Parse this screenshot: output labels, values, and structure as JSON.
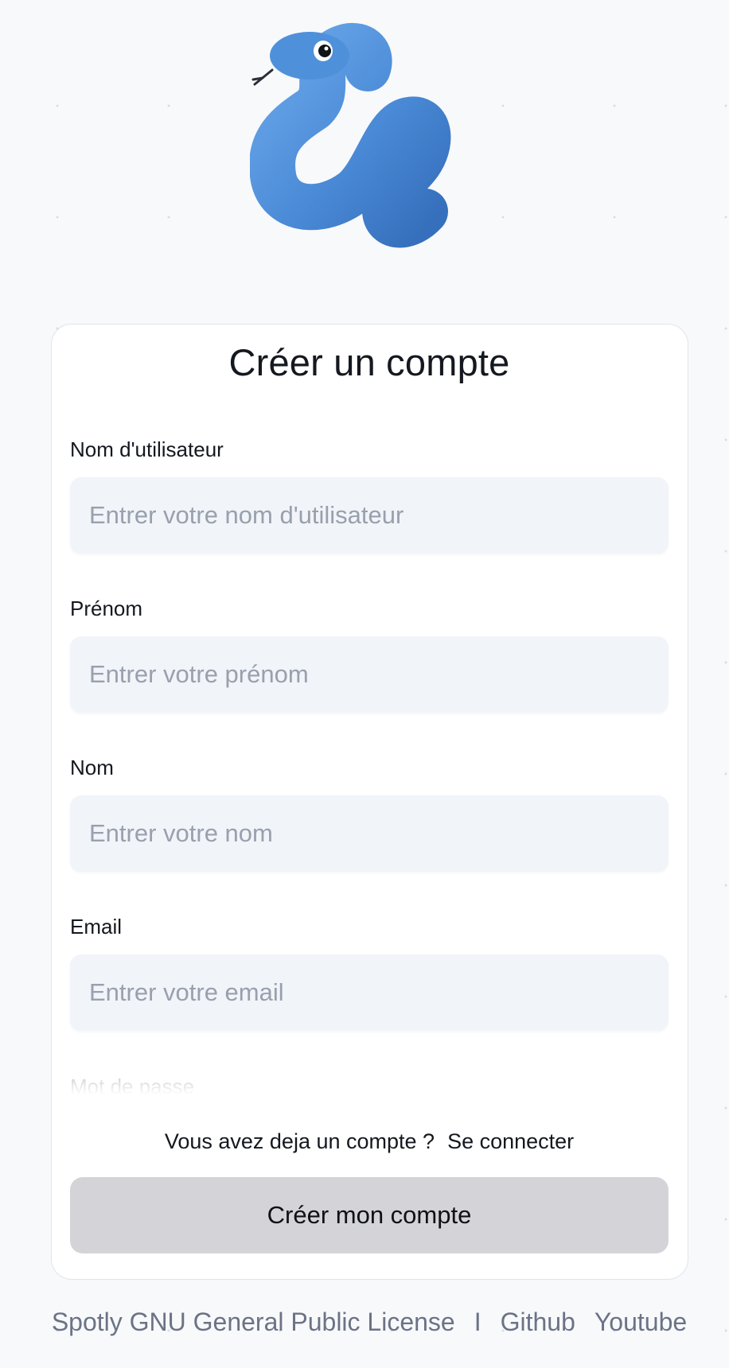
{
  "logo": {
    "icon": "snake-icon",
    "color": "#4a8ad6"
  },
  "form": {
    "title": "Créer un compte",
    "fields": [
      {
        "label": "Nom d'utilisateur",
        "placeholder": "Entrer votre nom d'utilisateur",
        "value": ""
      },
      {
        "label": "Prénom",
        "placeholder": "Entrer votre prénom",
        "value": ""
      },
      {
        "label": "Nom",
        "placeholder": "Entrer votre nom",
        "value": ""
      },
      {
        "label": "Email",
        "placeholder": "Entrer votre email",
        "value": ""
      }
    ],
    "password_label": "Mot de passe",
    "have_account_text": "Vous avez deja un compte ?",
    "login_link": "Se connecter",
    "submit_label": "Créer mon compte"
  },
  "footer": {
    "license": "Spotly GNU General Public License",
    "separator": "I",
    "github": "Github",
    "youtube": "Youtube"
  },
  "colors": {
    "page_background": "#f8f9fb",
    "input_background": "#f1f4f9",
    "button_background": "#d4d4d8",
    "footer_text": "#6b7385"
  }
}
